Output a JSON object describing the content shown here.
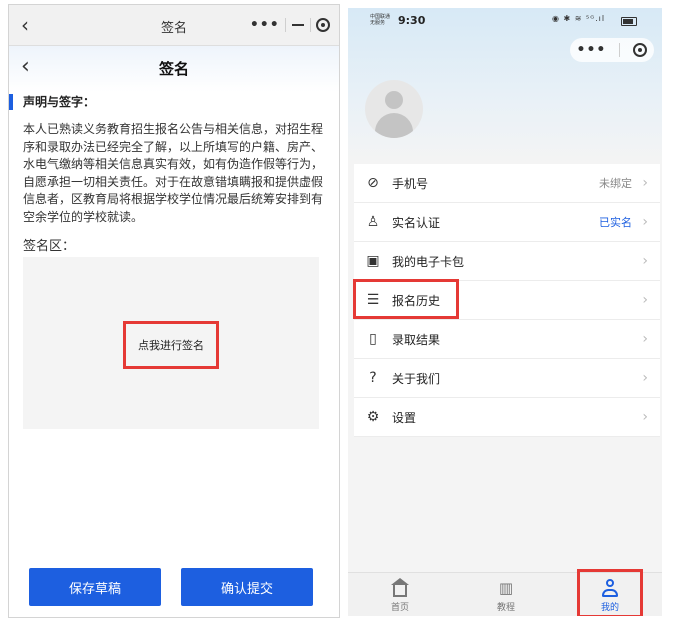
{
  "left_screen": {
    "window_title": "签名",
    "page_title": "签名",
    "declaration_title": "声明与签字：",
    "declaration_text": "本人已熟读义务教育招生报名公告与相关信息，对招生程序和录取办法已经完全了解，以上所填写的户籍、房产、水电气缴纳等相关信息真实有效，如有伪造作假等行为，自愿承担一切相关责任。对于在故意错填瞒报和提供虚假信息者，区教育局将根据学校学位情况最后统筹安排到有空余学位的学校就读。",
    "sign_area_label": "签名区：",
    "sign_button_label": "点我进行签名",
    "save_draft_label": "保存草稿",
    "confirm_submit_label": "确认提交",
    "accent_color": "#1d5fe0",
    "highlight_color": "#e53935"
  },
  "right_screen": {
    "status_bar": {
      "carrier_line1": "中国联通",
      "carrier_line2": "无服务",
      "time": "9:30",
      "icons": "◉ ✱ ≋ ⁵ᴳ.ıl"
    },
    "menu": [
      {
        "icon": "phone-slash-icon",
        "glyph": "⊘",
        "label": "手机号",
        "value": "未绑定",
        "value_style": "gray"
      },
      {
        "icon": "user-verify-icon",
        "glyph": "♙",
        "label": "实名认证",
        "value": "已实名",
        "value_style": "blue"
      },
      {
        "icon": "card-icon",
        "glyph": "▣",
        "label": "我的电子卡包",
        "value": "",
        "value_style": ""
      },
      {
        "icon": "document-list-icon",
        "glyph": "☰",
        "label": "报名历史",
        "value": "",
        "value_style": ""
      },
      {
        "icon": "book-icon",
        "glyph": "▯",
        "label": "录取结果",
        "value": "",
        "value_style": ""
      },
      {
        "icon": "question-icon",
        "glyph": "?",
        "label": "关于我们",
        "value": "",
        "value_style": ""
      },
      {
        "icon": "gear-icon",
        "glyph": "⚙",
        "label": "设置",
        "value": "",
        "value_style": ""
      }
    ],
    "tabs": [
      {
        "label": "首页",
        "icon": "home-icon"
      },
      {
        "label": "教程",
        "icon": "book-open-icon"
      },
      {
        "label": "我的",
        "icon": "person-icon"
      }
    ],
    "active_tab": "我的"
  }
}
